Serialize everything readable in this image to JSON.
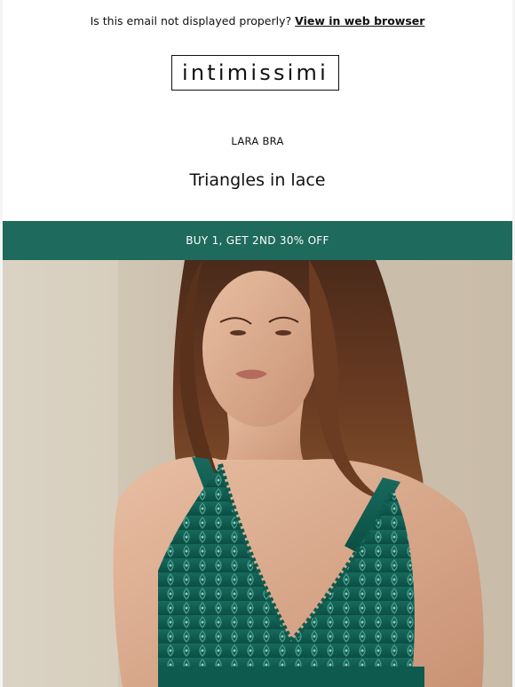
{
  "preheader": {
    "text": "Is this email not displayed properly?",
    "link_label": "View in web browser"
  },
  "brand": {
    "logo_text": "intimissimi"
  },
  "product": {
    "eyebrow": "LARA BRA",
    "headline": "Triangles in lace"
  },
  "promo": {
    "label": "BUY 1, GET 2ND 30% OFF",
    "color": "#1e6a5c"
  },
  "hero": {
    "description_icon": "model-photo",
    "accent_color": "#0f5a4e"
  }
}
